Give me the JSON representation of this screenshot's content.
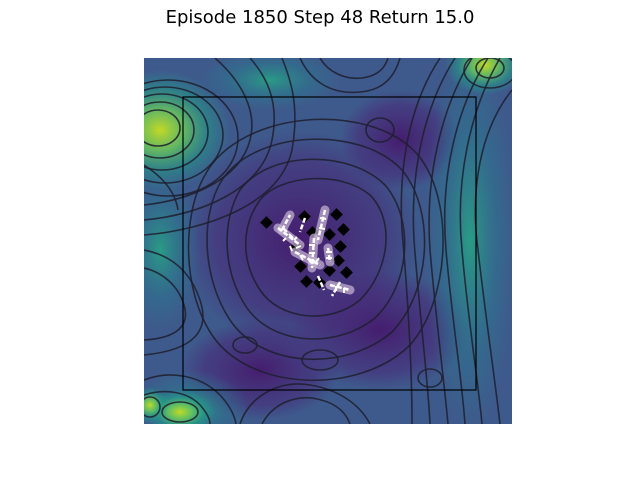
{
  "title": {
    "episode_label": "Episode",
    "episode": 1850,
    "step_label": "Step",
    "step": 48,
    "return_label": "Return",
    "return": "15.0",
    "text": "Episode 1850 Step 48 Return 15.0"
  },
  "colors": {
    "field_low": "#440154",
    "field_mid": "#3b5f8a",
    "field_high": "#21918c",
    "field_peak": "#b5de2b",
    "contour": "#1f1f2e",
    "arena_border": "#000000",
    "agent_body": "#ffffff",
    "agent_halo": "#c9b7d6",
    "food_item": "#000000"
  },
  "icons": {
    "agent": "white-cross-segment",
    "food": "black-diamond"
  }
}
